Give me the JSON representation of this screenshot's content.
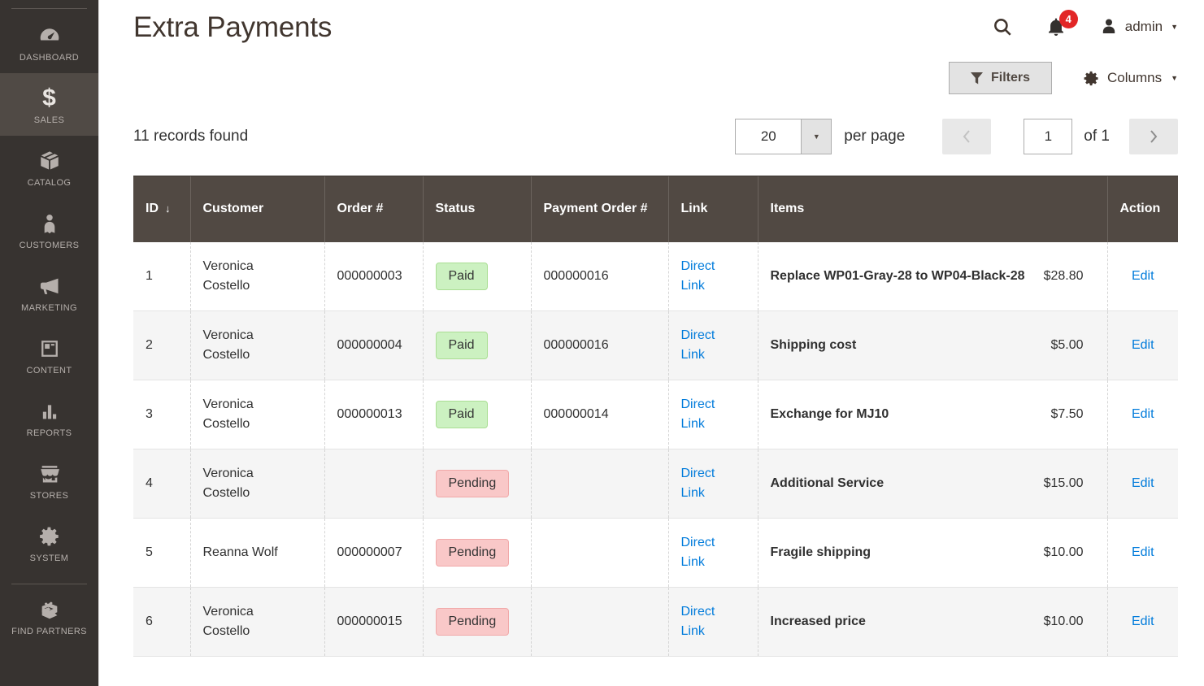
{
  "sidebar": {
    "items": [
      {
        "label": "DASHBOARD"
      },
      {
        "label": "SALES"
      },
      {
        "label": "CATALOG"
      },
      {
        "label": "CUSTOMERS"
      },
      {
        "label": "MARKETING"
      },
      {
        "label": "CONTENT"
      },
      {
        "label": "REPORTS"
      },
      {
        "label": "STORES"
      },
      {
        "label": "SYSTEM"
      },
      {
        "label": "FIND PARTNERS"
      }
    ]
  },
  "header": {
    "title": "Extra Payments",
    "notification_count": "4",
    "user_name": "admin"
  },
  "toolbar": {
    "filters_label": "Filters",
    "columns_label": "Columns"
  },
  "grid_controls": {
    "records_text": "11 records found",
    "per_page_value": "20",
    "per_page_label": "per page",
    "page_value": "1",
    "total_pages_label": "of 1"
  },
  "table": {
    "columns": {
      "id": "ID",
      "customer": "Customer",
      "order": "Order #",
      "status": "Status",
      "payment_order": "Payment Order #",
      "link": "Link",
      "items": "Items",
      "action": "Action"
    },
    "rows": [
      {
        "id": "1",
        "customer": "Veronica Costello",
        "order": "000000003",
        "status": "Paid",
        "payment_order": "000000016",
        "link": "Direct Link",
        "item": "Replace WP01-Gray-28 to WP04-Black-28",
        "price": "$28.80",
        "action": "Edit"
      },
      {
        "id": "2",
        "customer": "Veronica Costello",
        "order": "000000004",
        "status": "Paid",
        "payment_order": "000000016",
        "link": "Direct Link",
        "item": "Shipping cost",
        "price": "$5.00",
        "action": "Edit"
      },
      {
        "id": "3",
        "customer": "Veronica Costello",
        "order": "000000013",
        "status": "Paid",
        "payment_order": "000000014",
        "link": "Direct Link",
        "item": "Exchange for MJ10",
        "price": "$7.50",
        "action": "Edit"
      },
      {
        "id": "4",
        "customer": "Veronica Costello",
        "order": "",
        "status": "Pending",
        "payment_order": "",
        "link": "Direct Link",
        "item": "Additional Service",
        "price": "$15.00",
        "action": "Edit"
      },
      {
        "id": "5",
        "customer": "Reanna Wolf",
        "order": "000000007",
        "status": "Pending",
        "payment_order": "",
        "link": "Direct Link",
        "item": "Fragile shipping",
        "price": "$10.00",
        "action": "Edit"
      },
      {
        "id": "6",
        "customer": "Veronica Costello",
        "order": "000000015",
        "status": "Pending",
        "payment_order": "",
        "link": "Direct Link",
        "item": "Increased price",
        "price": "$10.00",
        "action": "Edit"
      }
    ]
  },
  "colors": {
    "sidebar_bg": "#373330",
    "sidebar_active_bg": "#504a45",
    "table_header_bg": "#514943",
    "accent_red": "#e22626",
    "link_blue": "#007bdb",
    "paid_bg": "#ccf1c1",
    "pending_bg": "#f9c8c8",
    "button_bg": "#e3e3e3"
  }
}
